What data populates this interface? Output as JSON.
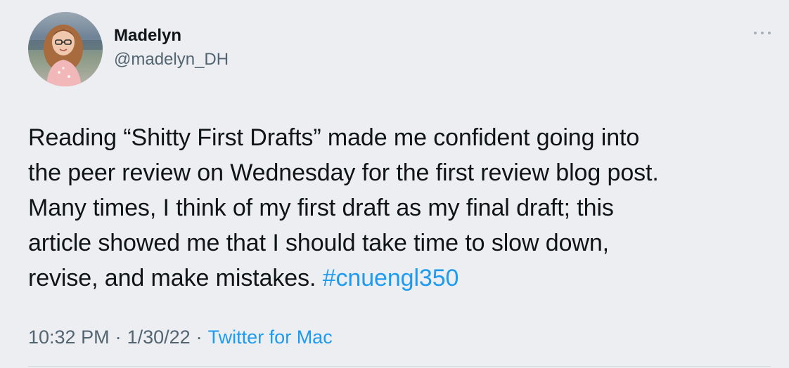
{
  "author": {
    "name": "Madelyn",
    "handle": "@madelyn_DH"
  },
  "tweet": {
    "lines": [
      "Reading “Shitty First Drafts” made me confident going into",
      "the peer review on Wednesday for the first review blog post.",
      "Many times, I think of my first draft as my final draft; this",
      "article showed me that I should take time to slow down,",
      "revise, and make mistakes."
    ],
    "hashtag": "#cnuengl350"
  },
  "meta": {
    "time": "10:32 PM",
    "date": "1/30/22",
    "separator": "·",
    "source": "Twitter for Mac"
  },
  "colors": {
    "background": "#eceef1",
    "text": "#0f1419",
    "secondary_text": "#536471",
    "link": "#1d9bf0"
  },
  "icons": {
    "more": "more-horizontal-icon",
    "avatar": "profile-photo"
  }
}
